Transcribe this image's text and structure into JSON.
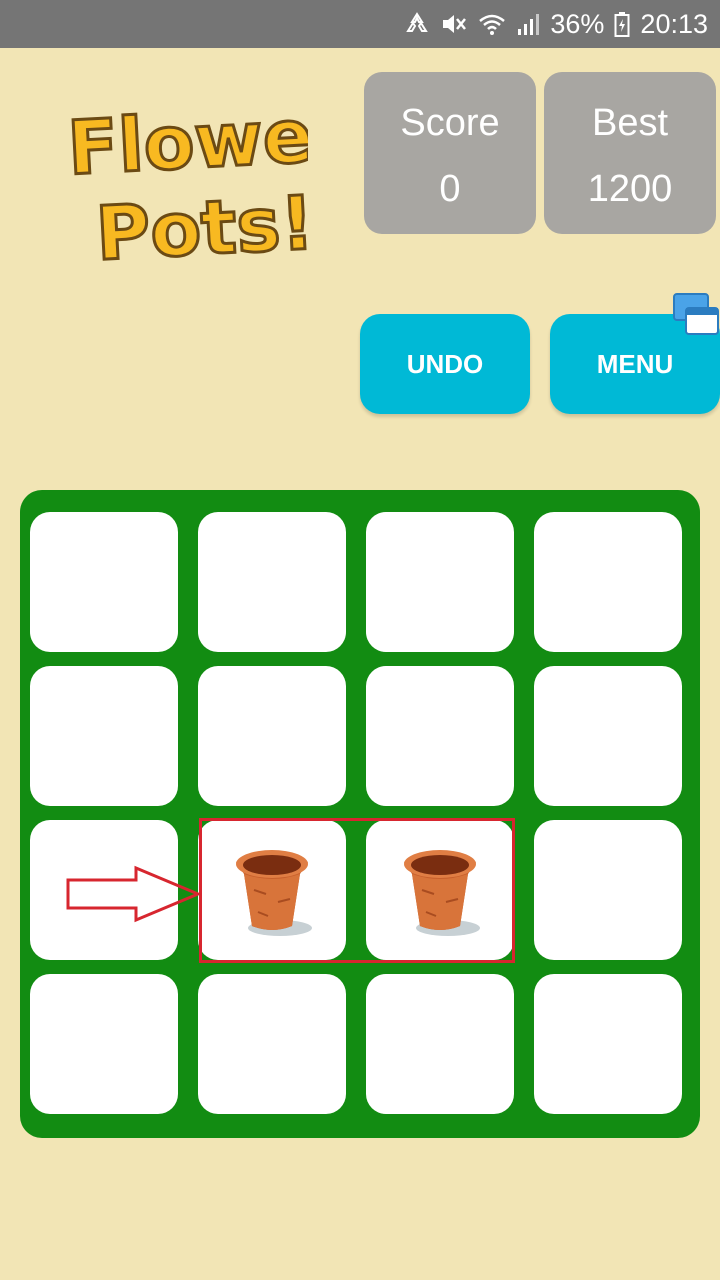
{
  "status_bar": {
    "battery": "36%",
    "time": "20:13",
    "icons": [
      "recycle-icon",
      "mute-icon",
      "wifi-icon",
      "signal-icon",
      "battery-icon"
    ]
  },
  "logo": {
    "line1": "Flower",
    "line2": "Pots!"
  },
  "score": {
    "label": "Score",
    "value": "0"
  },
  "best": {
    "label": "Best",
    "value": "1200"
  },
  "buttons": {
    "undo": "UNDO",
    "menu": "MENU"
  },
  "board": {
    "rows": 4,
    "cols": 4,
    "tiles": [
      [
        "",
        "",
        "",
        ""
      ],
      [
        "",
        "",
        "",
        ""
      ],
      [
        "",
        "flower-pot",
        "flower-pot",
        ""
      ],
      [
        "",
        "",
        "",
        ""
      ]
    ]
  },
  "annotations": {
    "highlight": "red-rectangle-around-row3-col2-col3",
    "arrow": "red-outline-arrow-right"
  },
  "colors": {
    "background": "#f2e5b5",
    "board": "#128c12",
    "button": "#00b9d6",
    "score_box": "#a8a6a2",
    "logo_yellow": "#f8b921",
    "highlight": "#d7262f"
  }
}
